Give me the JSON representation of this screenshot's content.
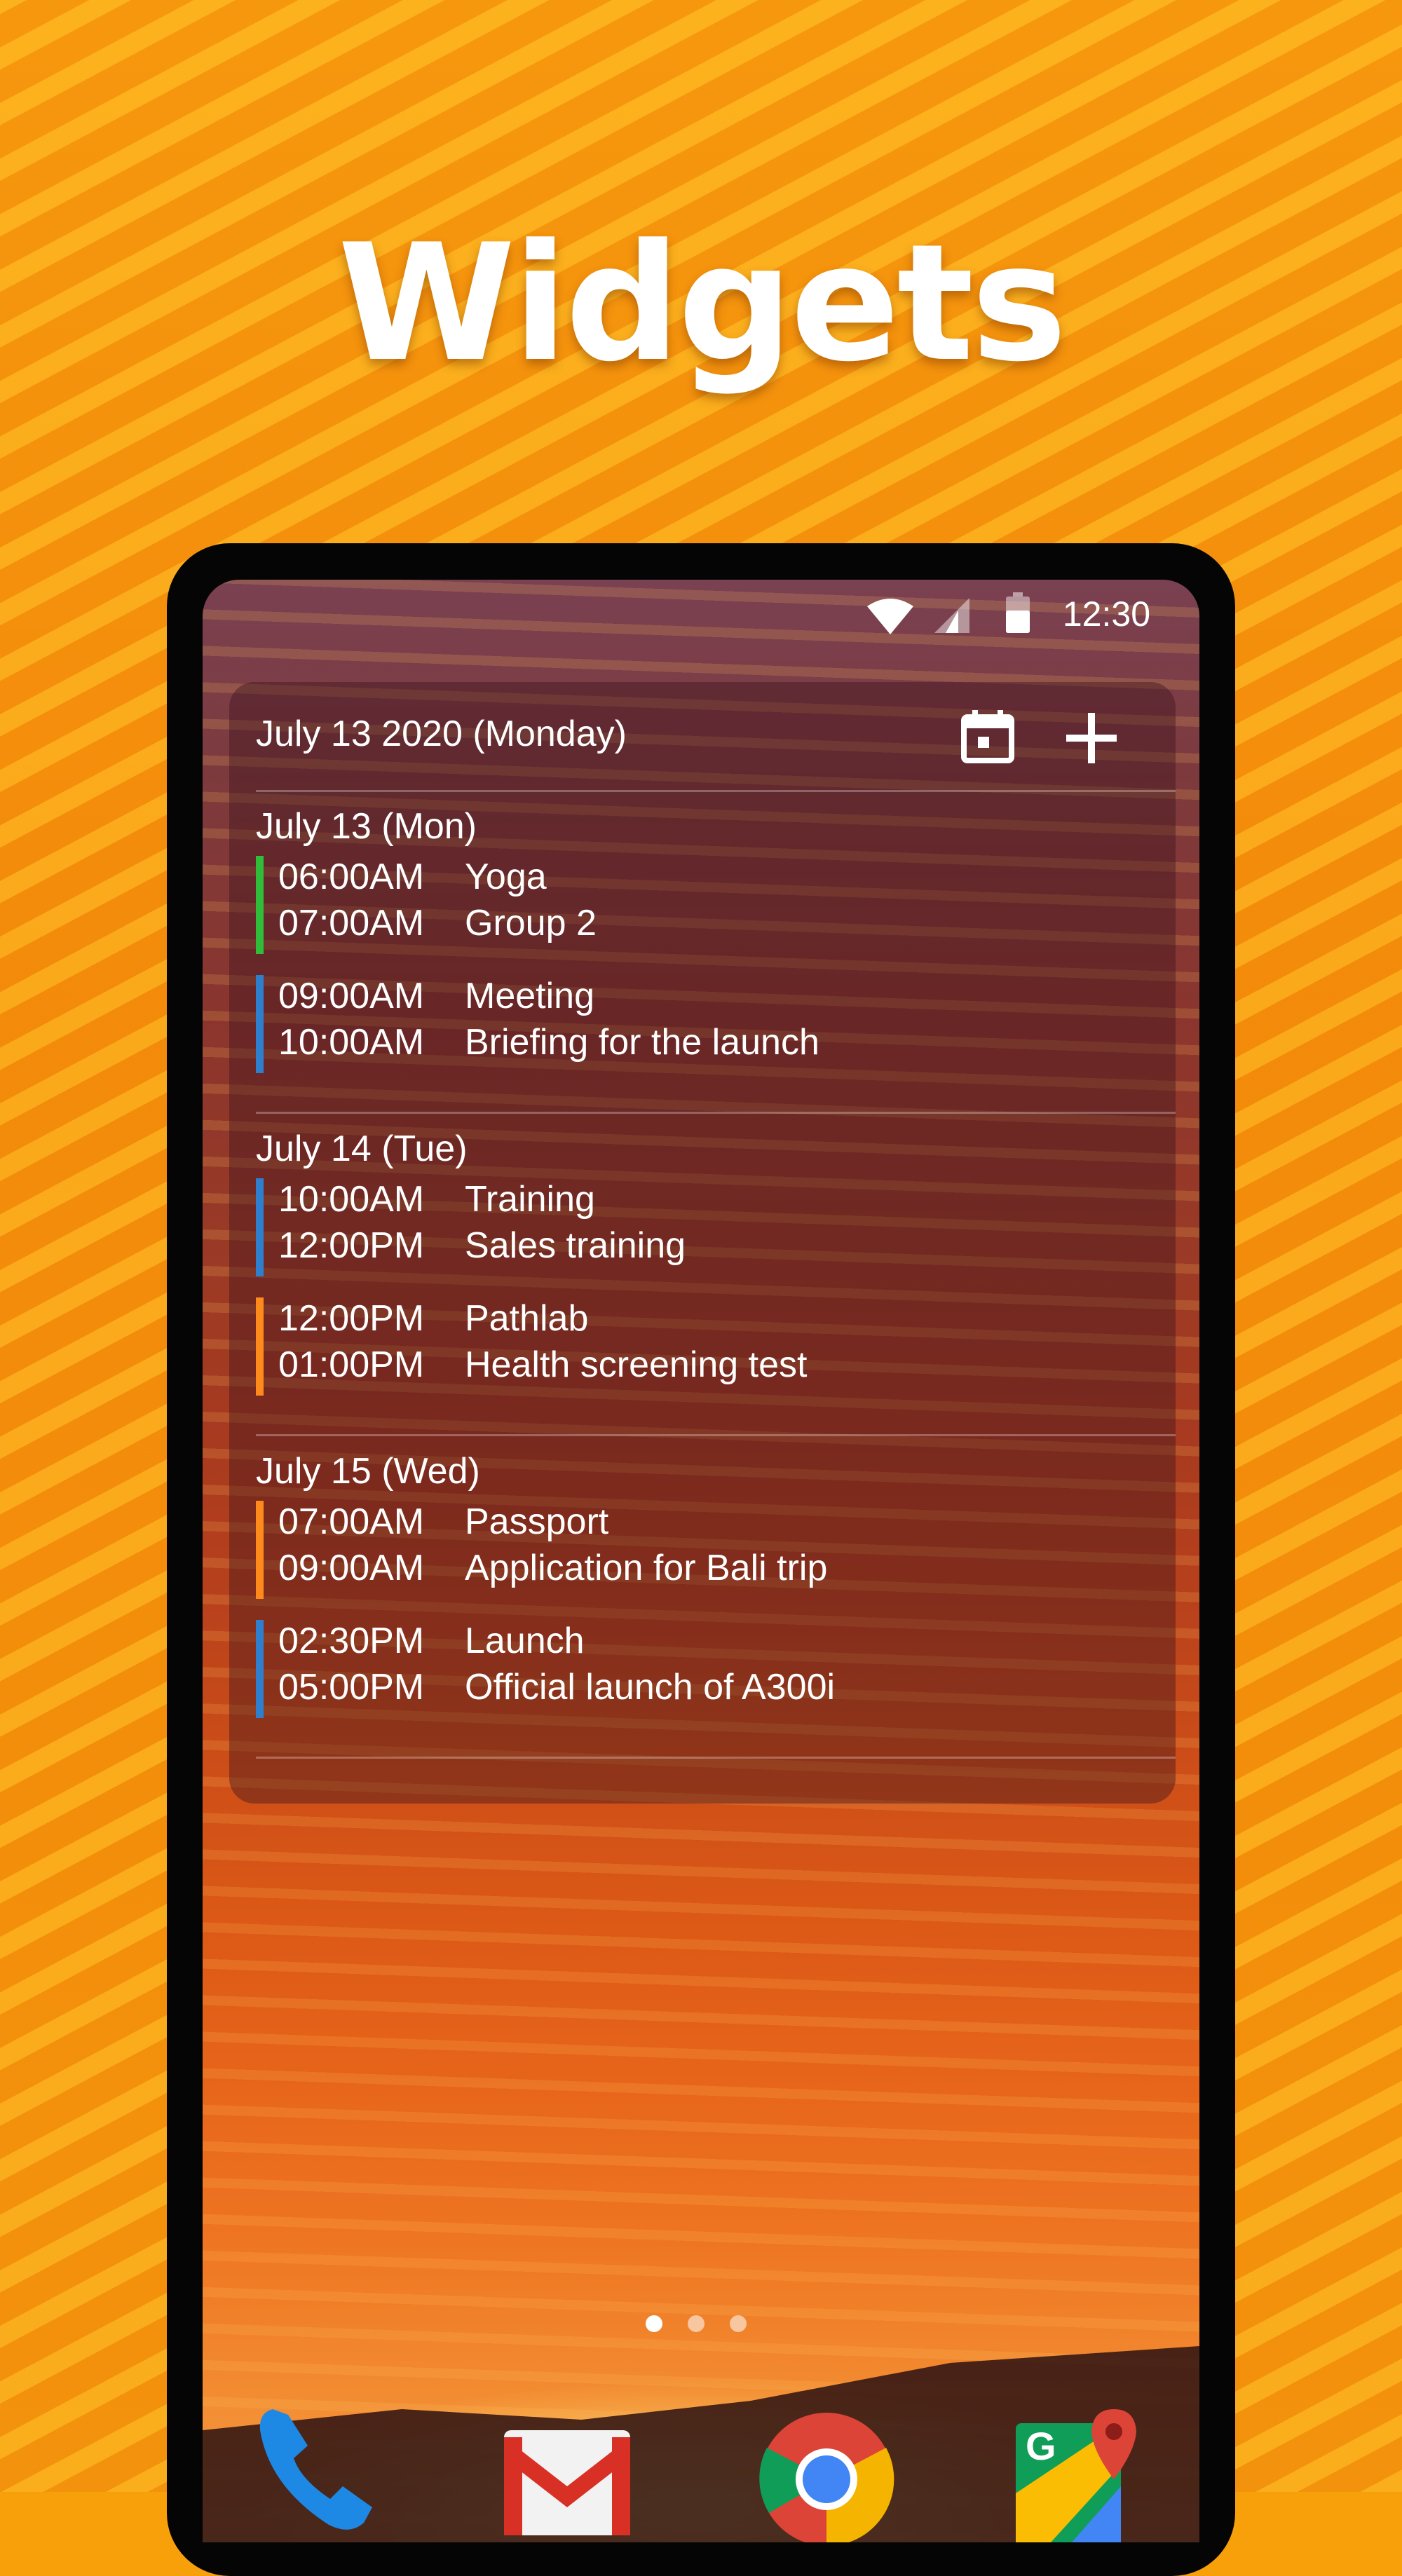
{
  "headline": "Widgets",
  "status_bar": {
    "time": "12:30"
  },
  "widget": {
    "header_date": "July 13 2020 (Monday)",
    "days": [
      {
        "label": "July 13 (Mon)",
        "events": [
          {
            "start": "06:00AM",
            "title": "Yoga",
            "end": "07:00AM",
            "detail": "Group 2",
            "color": "#2fbd3a"
          },
          {
            "start": "09:00AM",
            "title": "Meeting",
            "end": "10:00AM",
            "detail": "Briefing for the launch",
            "color": "#2f7fcf"
          }
        ]
      },
      {
        "label": "July 14 (Tue)",
        "events": [
          {
            "start": "10:00AM",
            "title": "Training",
            "end": "12:00PM",
            "detail": "Sales training",
            "color": "#2f7fcf"
          },
          {
            "start": "12:00PM",
            "title": "Pathlab",
            "end": "01:00PM",
            "detail": "Health screening test",
            "color": "#ff8a1c"
          }
        ]
      },
      {
        "label": "July 15 (Wed)",
        "events": [
          {
            "start": "07:00AM",
            "title": "Passport",
            "end": "09:00AM",
            "detail": "Application for Bali trip",
            "color": "#ff8a1c"
          },
          {
            "start": "02:30PM",
            "title": "Launch",
            "end": "05:00PM",
            "detail": "Official launch of A300i",
            "color": "#2f7fcf"
          }
        ]
      }
    ]
  },
  "dock": {
    "apps": [
      "phone-icon",
      "gmail-icon",
      "chrome-icon",
      "maps-icon"
    ]
  },
  "colors": {
    "background": "#f7a00a",
    "accent_green": "#2fbd3a",
    "accent_blue": "#2f7fcf",
    "accent_orange": "#ff8a1c"
  }
}
